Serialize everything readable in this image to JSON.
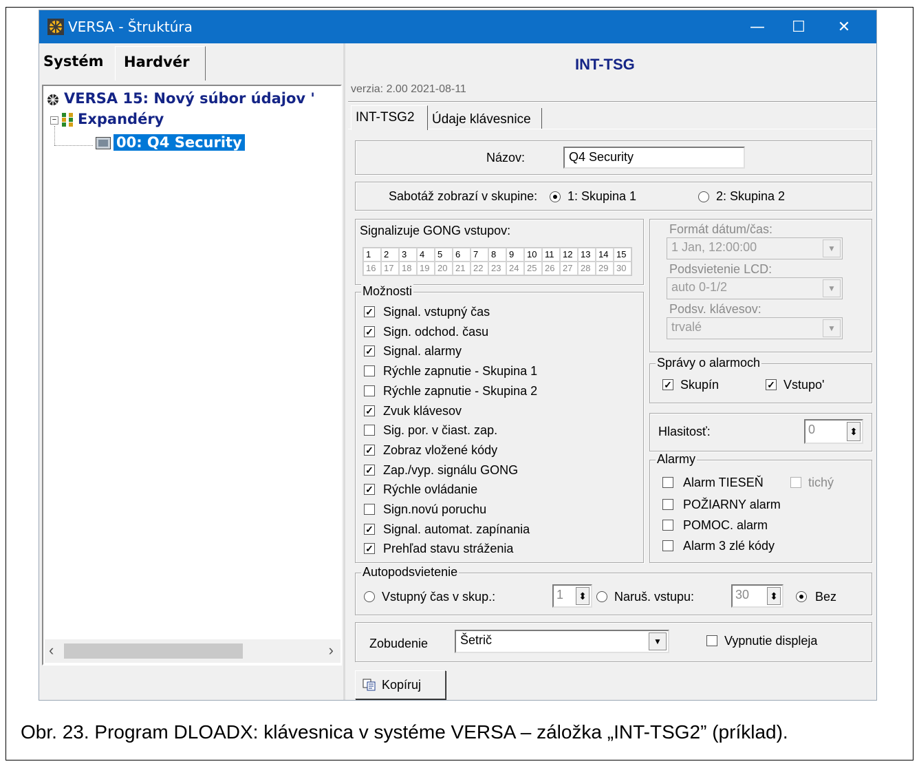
{
  "window": {
    "title": "VERSA - Štruktúra",
    "controls": {
      "minimize": "—",
      "maximize": "☐",
      "close": "✕"
    }
  },
  "left": {
    "tabs": [
      "Systém",
      "Hardvér"
    ],
    "tree": [
      {
        "label": "VERSA 15: Nový súbor údajov '"
      },
      {
        "label": "Expandéry"
      },
      {
        "label": "00: Q4 Security",
        "selected": true
      }
    ],
    "scroll_left": "‹",
    "scroll_right": "›"
  },
  "right": {
    "module_title": "INT-TSG",
    "version": "verzia: 2.00 2021-08-11",
    "tabs": [
      "INT-TSG2",
      "Údaje klávesnice"
    ],
    "name_label": "Názov:",
    "name_value": "Q4 Security",
    "tamper_label": "Sabotáž zobrazí v skupine:",
    "tamper_opt1": "1: Skupina 1",
    "tamper_opt2": "2: Skupina 2",
    "gong_label": "Signalizuje GONG vstupov:",
    "gong_row1": [
      "1",
      "2",
      "3",
      "4",
      "5",
      "6",
      "7",
      "8",
      "9",
      "10",
      "11",
      "12",
      "13",
      "14",
      "15"
    ],
    "gong_row2": [
      "16",
      "17",
      "18",
      "19",
      "20",
      "21",
      "22",
      "23",
      "24",
      "25",
      "26",
      "27",
      "28",
      "29",
      "30"
    ],
    "options_label": "Možnosti",
    "options": [
      {
        "label": "Signal. vstupný čas",
        "checked": true
      },
      {
        "label": "Sign. odchod. času",
        "checked": true
      },
      {
        "label": "Signal. alarmy",
        "checked": true
      },
      {
        "label": "Rýchle zapnutie - Skupina 1",
        "checked": false
      },
      {
        "label": "Rýchle zapnutie - Skupina 2",
        "checked": false
      },
      {
        "label": "Zvuk klávesov",
        "checked": true
      },
      {
        "label": "Sig. por. v čiast. zap.",
        "checked": false
      },
      {
        "label": "Zobraz vložené kódy",
        "checked": true
      },
      {
        "label": "Zap./vyp. signálu GONG",
        "checked": true
      },
      {
        "label": "Rýchle ovládanie",
        "checked": true
      },
      {
        "label": "Sign.novú poruchu",
        "checked": false
      },
      {
        "label": "Signal. automat. zapínania",
        "checked": true
      },
      {
        "label": "Prehľad stavu stráženia",
        "checked": true
      }
    ],
    "format_label": "Formát dátum/čas:",
    "format_value": "1 Jan, 12:00:00",
    "lcd_label": "Podsvietenie LCD:",
    "lcd_value": "auto 0-1/2",
    "keys_label": "Podsv. klávesov:",
    "keys_value": "trvalé",
    "messages_label": "Správy o alarmoch",
    "msg_groups": "Skupín",
    "msg_inputs": "Vstupo'",
    "volume_label": "Hlasitosť:",
    "volume_value": "0",
    "alarms_label": "Alarmy",
    "alarm_panic": "Alarm TIESEŇ",
    "alarm_silent": "tichý",
    "alarm_fire": "POŽIARNY alarm",
    "alarm_aux": "POMOC. alarm",
    "alarm_codes": "Alarm 3 zlé kódy",
    "backlight_label": "Autopodsvietenie",
    "bl_entry": "Vstupný čas v skup.:",
    "bl_entry_value": "1",
    "bl_violation": "Naruš. vstupu:",
    "bl_violation_value": "30",
    "bl_none": "Bez",
    "wake_label": "Zobudenie",
    "wake_value": "Šetrič",
    "display_off": "Vypnutie displeja",
    "copy_button": "Kopíruj"
  },
  "caption": "Obr. 23. Program DLOADX: klávesnica v systéme VERSA – záložka „INT-TSG2” (príklad)."
}
